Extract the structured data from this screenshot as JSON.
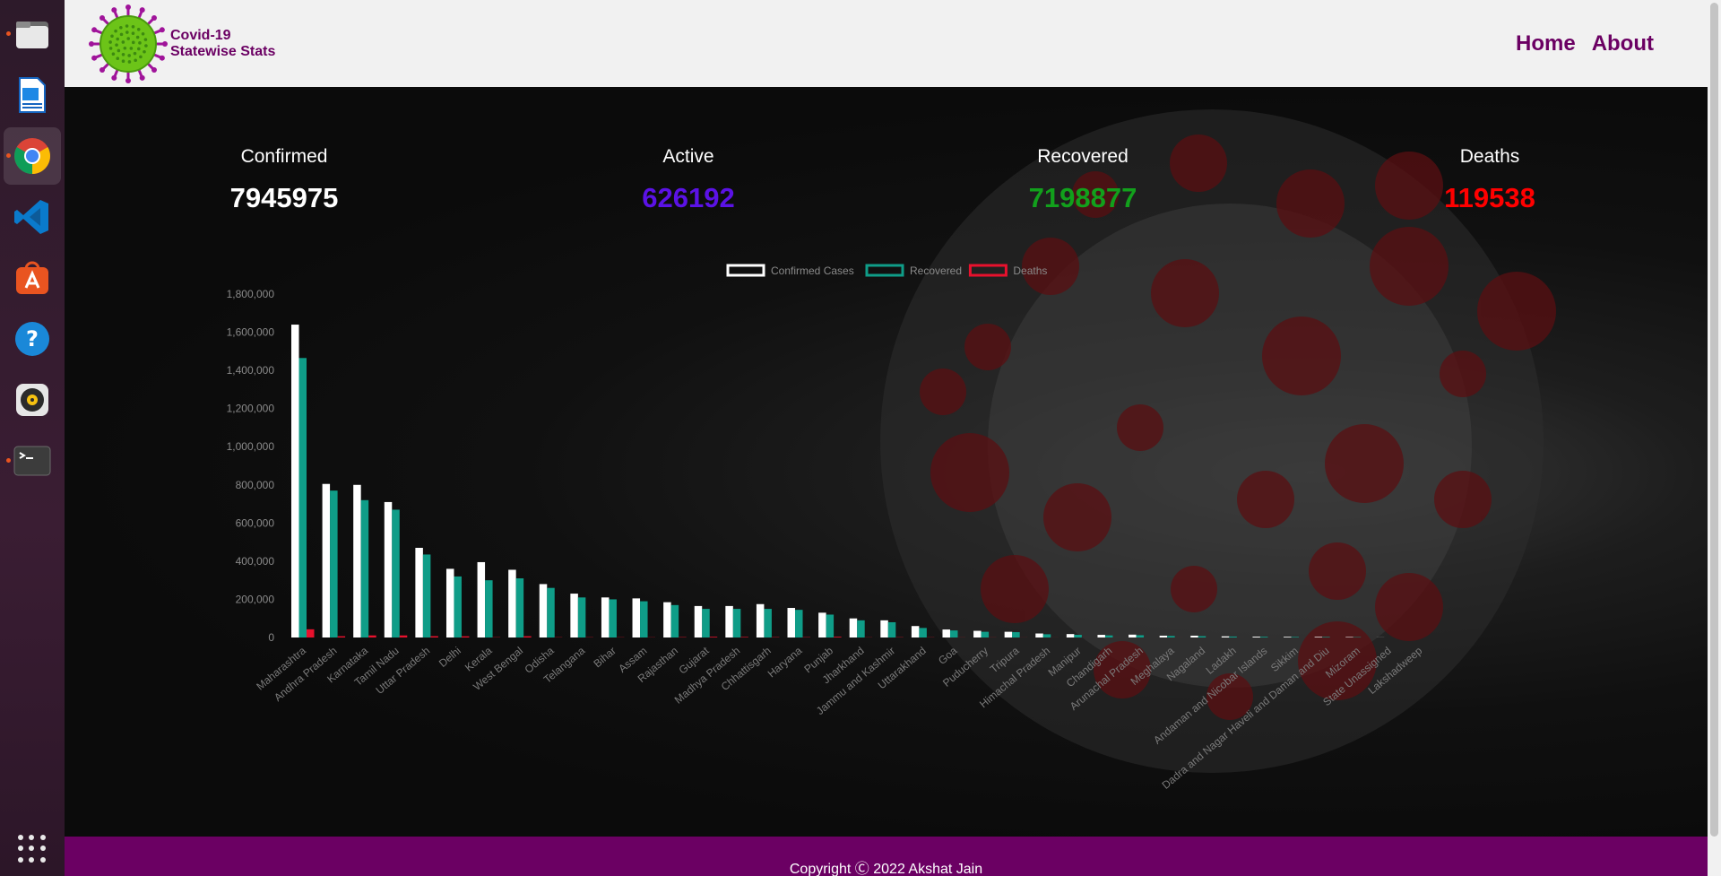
{
  "navbar": {
    "brand_line1": "Covid-19",
    "brand_line2": "Statewise Stats",
    "links": [
      "Home",
      "About"
    ]
  },
  "stats": [
    {
      "label": "Confirmed",
      "value": "7945975",
      "color": "#ffffff"
    },
    {
      "label": "Active",
      "value": "626192",
      "color": "#5b12e6"
    },
    {
      "label": "Recovered",
      "value": "7198877",
      "color": "#12a01c"
    },
    {
      "label": "Deaths",
      "value": "119538",
      "color": "#ff0000"
    }
  ],
  "footer": {
    "text": "Copyright Ⓒ 2022 Akshat Jain"
  },
  "dock": [
    {
      "name": "files-icon",
      "running": true
    },
    {
      "name": "libreoffice-writer-icon",
      "running": false
    },
    {
      "name": "chrome-icon",
      "running": true,
      "active": true
    },
    {
      "name": "vscode-icon",
      "running": false
    },
    {
      "name": "ubuntu-software-icon",
      "running": false
    },
    {
      "name": "help-icon",
      "running": false
    },
    {
      "name": "rhythmbox-icon",
      "running": false
    },
    {
      "name": "terminal-icon",
      "running": true
    }
  ],
  "chart_data": {
    "type": "bar",
    "legend": [
      {
        "label": "Confirmed Cases",
        "color": "#ffffff"
      },
      {
        "label": "Recovered",
        "color": "#0f9d88"
      },
      {
        "label": "Deaths",
        "color": "#e8112d"
      }
    ],
    "ylim": [
      0,
      1800000
    ],
    "yticks": [
      "0",
      "200,000",
      "400,000",
      "600,000",
      "800,000",
      "1,000,000",
      "1,200,000",
      "1,400,000",
      "1,600,000",
      "1,800,000"
    ],
    "grid": false,
    "legend_position": "top-center",
    "categories": [
      "Maharashtra",
      "Andhra Pradesh",
      "Karnataka",
      "Tamil Nadu",
      "Uttar Pradesh",
      "Delhi",
      "Kerala",
      "West Bengal",
      "Odisha",
      "Telangana",
      "Bihar",
      "Assam",
      "Rajasthan",
      "Gujarat",
      "Madhya Pradesh",
      "Chhattisgarh",
      "Haryana",
      "Punjab",
      "Jharkhand",
      "Jammu and Kashmir",
      "Uttarakhand",
      "Goa",
      "Puducherry",
      "Tripura",
      "Himachal Pradesh",
      "Manipur",
      "Chandigarh",
      "Arunachal Pradesh",
      "Meghalaya",
      "Nagaland",
      "Ladakh",
      "Andaman and Nicobar Islands",
      "Sikkim",
      "Dadra and Nagar Haveli and Daman and Diu",
      "Mizoram",
      "State Unassigned",
      "Lakshadweep"
    ],
    "series": [
      {
        "name": "Confirmed Cases",
        "values": [
          1640000,
          805000,
          800000,
          710000,
          470000,
          360000,
          395000,
          355000,
          280000,
          230000,
          210000,
          205000,
          185000,
          165000,
          165000,
          175000,
          155000,
          130000,
          100000,
          90000,
          60000,
          42000,
          35000,
          30000,
          21000,
          18000,
          14000,
          15000,
          9500,
          9500,
          6000,
          4500,
          3700,
          3300,
          2500,
          500,
          0
        ]
      },
      {
        "name": "Recovered",
        "values": [
          1465000,
          770000,
          720000,
          670000,
          435000,
          320000,
          300000,
          310000,
          260000,
          210000,
          200000,
          190000,
          170000,
          150000,
          150000,
          150000,
          145000,
          120000,
          90000,
          80000,
          50000,
          37000,
          30000,
          28000,
          17000,
          14000,
          11000,
          12000,
          8000,
          7000,
          5000,
          4000,
          3000,
          3000,
          2000,
          0,
          0
        ]
      },
      {
        "name": "Deaths",
        "values": [
          43000,
          6600,
          11000,
          10900,
          6900,
          6200,
          1400,
          6600,
          1300,
          1300,
          1100,
          1000,
          1900,
          3700,
          2800,
          1800,
          1700,
          4000,
          900,
          1400,
          1000,
          600,
          580,
          350,
          300,
          180,
          220,
          40,
          90,
          40,
          70,
          60,
          70,
          2,
          0,
          0,
          0
        ]
      }
    ]
  }
}
